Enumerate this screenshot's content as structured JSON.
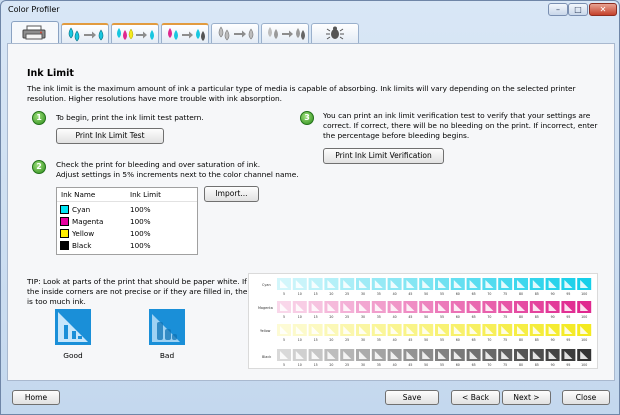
{
  "window": {
    "title": "Color Profiler",
    "minimize_glyph": "–",
    "maximize_glyph": "□",
    "close_glyph": "✕"
  },
  "tabs": [
    {
      "icon": "printer-icon",
      "state": "active"
    },
    {
      "icon": "ink-drops-to-ink-icon",
      "state": "done"
    },
    {
      "icon": "cmyk-drops-to-ink-icon",
      "state": "done"
    },
    {
      "icon": "drops-to-drops-icon",
      "state": "done"
    },
    {
      "icon": "gray-drops-to-ink-icon",
      "state": "pending"
    },
    {
      "icon": "gray-drops-to-drops-icon",
      "state": "pending"
    },
    {
      "icon": "bug-icon",
      "state": "pending"
    }
  ],
  "main": {
    "heading": "Ink Limit",
    "intro": "The ink limit is the maximum amount of ink a particular type of media is capable of absorbing. Ink limits will vary depending on the selected printer resolution. Higher resolutions have more trouble with ink absorption."
  },
  "steps": [
    {
      "number": "1",
      "text": "To begin, print the ink limit test pattern.",
      "button": "Print Ink Limit Test"
    },
    {
      "number": "2",
      "text_line1": "Check the print for bleeding and over saturation of ink.",
      "text_line2": "Adjust settings in 5% increments next to the color channel name.",
      "button": "Import..."
    },
    {
      "number": "3",
      "text": "You can print an ink limit verification test to verify that your settings are correct. If correct, there will be no bleeding on the print. If incorrect, enter the percentage before bleeding begins.",
      "button": "Print Ink Limit Verification"
    }
  ],
  "ink_table": {
    "headers": [
      "Ink Name",
      "Ink Limit"
    ],
    "rows": [
      {
        "name": "Cyan",
        "limit": "100%",
        "color": "#00e5f5"
      },
      {
        "name": "Magenta",
        "limit": "100%",
        "color": "#e600a0"
      },
      {
        "name": "Yellow",
        "limit": "100%",
        "color": "#ffee00"
      },
      {
        "name": "Black",
        "limit": "100%",
        "color": "#000000"
      }
    ]
  },
  "tip": {
    "text": "TIP: Look at parts of the print that should be paper white. If the inside corners are not precise or if they are filled in, there is too much ink.",
    "good_label": "Good",
    "bad_label": "Bad",
    "sample_color": "#1a8fd8"
  },
  "test_print": {
    "channels": [
      {
        "name": "Cyan",
        "color": "#16cfe9"
      },
      {
        "name": "Magenta",
        "color": "#e0288f"
      },
      {
        "name": "Yellow",
        "color": "#f4ea1f"
      },
      {
        "name": "Black",
        "color": "#333333"
      }
    ],
    "ticks": [
      "5",
      "10",
      "15",
      "20",
      "25",
      "30",
      "35",
      "40",
      "45",
      "50",
      "55",
      "60",
      "65",
      "70",
      "75",
      "80",
      "85",
      "90",
      "95",
      "100"
    ]
  },
  "footer": {
    "home": "Home",
    "save": "Save",
    "back": "< Back",
    "next": "Next >",
    "close": "Close"
  }
}
